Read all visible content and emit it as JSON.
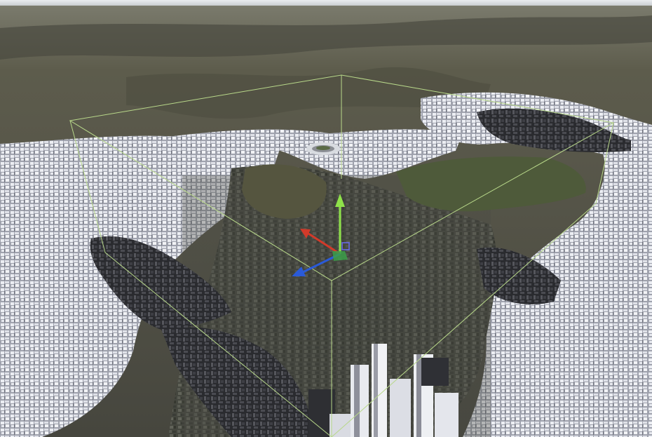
{
  "scene": {
    "description_visible_text": "",
    "colors": {
      "sky": "#dfe3e6",
      "far_terrain": "#59584a",
      "mid_terrain": "#6b6a55",
      "urban_ground": "#4b4c45",
      "building_white": "#e3e5ec",
      "building_shade": "#8d8f99",
      "dark_buildings": "#2d2e32",
      "park_green": "#4e5a3a",
      "bounds_box": "#b8d88a",
      "gizmo_x": "#d23a2a",
      "gizmo_y": "#8fe24a",
      "gizmo_z": "#2a5ad8",
      "gizmo_center": "#3ca04a"
    },
    "icons": {
      "transform_gizmo": "move-gizmo-icon",
      "stadium": "stadium-icon"
    }
  }
}
